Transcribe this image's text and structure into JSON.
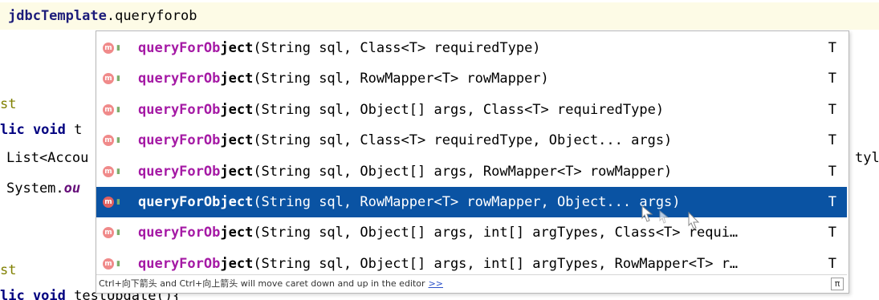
{
  "editor": {
    "top_line": {
      "object": "jdbcTemplate",
      "dot": ".",
      "typed": "queryforob"
    },
    "left_fragments": {
      "anno1": "st",
      "line_a": {
        "kw": "lic void",
        "rest": " t"
      },
      "line_b": "List<Accou",
      "line_c": {
        "prefix": "System.",
        "field": "ou"
      },
      "anno2": "st",
      "line_d": {
        "kw": "lic void",
        "rest": " testUpdate(){"
      },
      "right_fragment": "tyl"
    }
  },
  "completion": {
    "items": [
      {
        "match": "queryForOb",
        "rest": "ject",
        "params": "(String sql, Class<T> requiredType)",
        "return_type": "T"
      },
      {
        "match": "queryForOb",
        "rest": "ject",
        "params": "(String sql, RowMapper<T> rowMapper)",
        "return_type": "T"
      },
      {
        "match": "queryForOb",
        "rest": "ject",
        "params": "(String sql, Object[] args, Class<T> requiredType)",
        "return_type": "T"
      },
      {
        "match": "queryForOb",
        "rest": "ject",
        "params": "(String sql, Class<T> requiredType, Object... args)",
        "return_type": "T"
      },
      {
        "match": "queryForOb",
        "rest": "ject",
        "params": "(String sql, Object[] args, RowMapper<T> rowMapper)",
        "return_type": "T"
      },
      {
        "match": "queryForOb",
        "rest": "ject",
        "params": "(String sql, RowMapper<T> rowMapper, Object... args)",
        "return_type": "T",
        "selected": true
      },
      {
        "match": "queryForOb",
        "rest": "ject",
        "params": "(String sql, Object[] args, int[] argTypes, Class<T> requi…",
        "return_type": "T"
      },
      {
        "match": "queryForOb",
        "rest": "ject",
        "params": "(String sql, Object[] args, int[] argTypes, RowMapper<T> r…",
        "return_type": "T"
      }
    ],
    "icon_letter": "m",
    "footer_hint": "Ctrl+向下箭头 and Ctrl+向上箭头 will move caret down and up in the editor",
    "footer_link": ">>",
    "footer_pi": "π"
  }
}
